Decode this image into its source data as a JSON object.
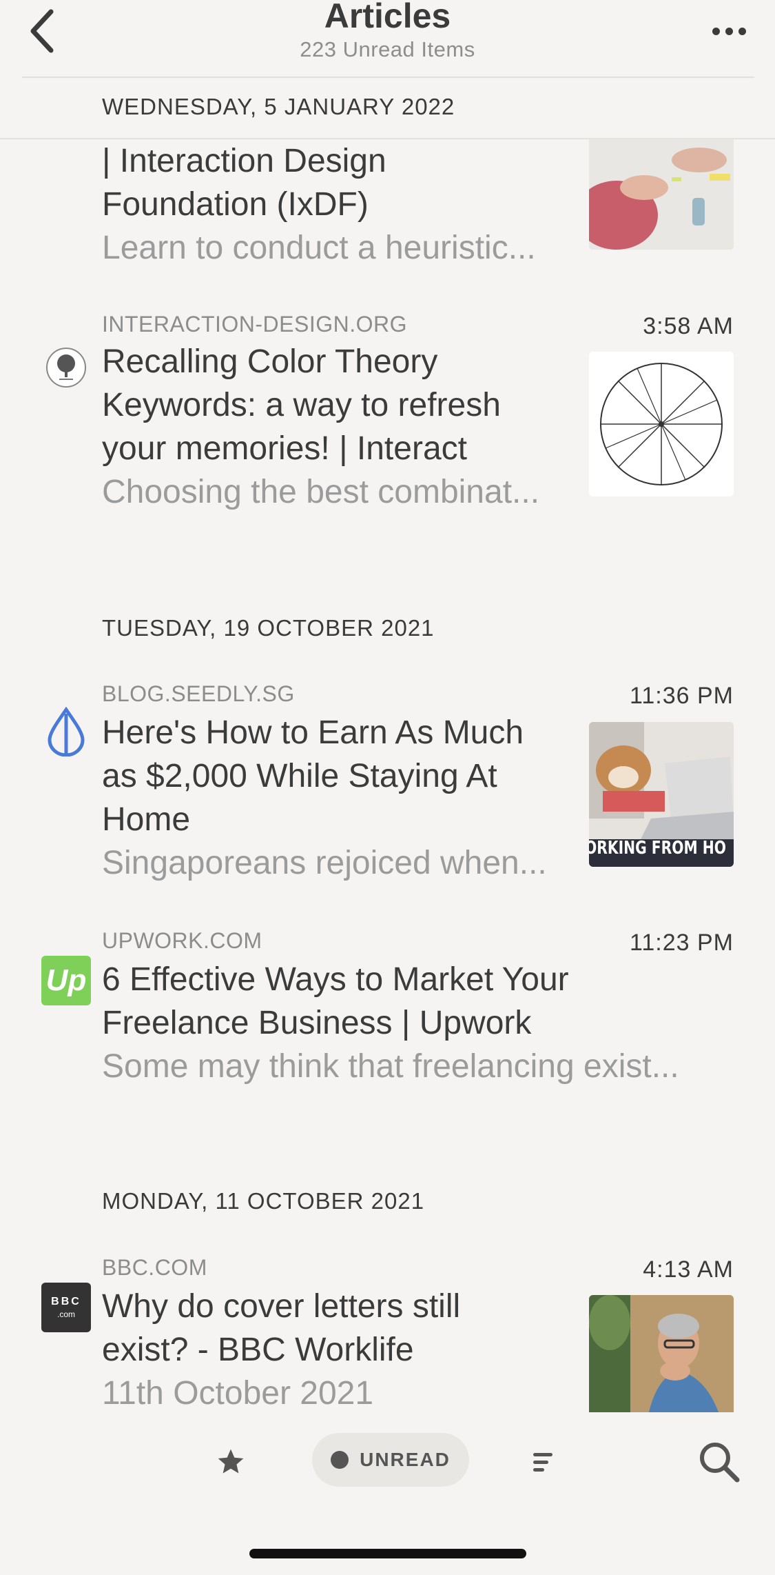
{
  "header": {
    "title": "Articles",
    "subtitle": "223 Unread Items"
  },
  "sections": [
    {
      "date": "WEDNESDAY, 5 JANUARY 2022",
      "items": [
        {
          "title_line1": "| Interaction Design",
          "title_line2": "Foundation (IxDF)",
          "summary": "Learn to conduct a heuristic..."
        },
        {
          "source": "INTERACTION-DESIGN.ORG",
          "time": "3:58 AM",
          "title_line1": "Recalling Color Theory",
          "title_line2": "Keywords: a way to refresh",
          "title_line3": "your memories! | Interact",
          "summary": "Choosing the best combinat...",
          "favicon": "tree-logo-icon"
        }
      ]
    },
    {
      "date": "TUESDAY, 19 OCTOBER 2021",
      "items": [
        {
          "source": "BLOG.SEEDLY.SG",
          "time": "11:36 PM",
          "title_line1": "Here's How to Earn As Much",
          "title_line2": "as $2,000 While Staying At",
          "title_line3": "Home",
          "summary": "Singaporeans rejoiced when...",
          "thumb_caption": "ORKING FROM HO",
          "favicon": "seedly-drop-icon"
        },
        {
          "source": "UPWORK.COM",
          "time": "11:23 PM",
          "title_line1": "6 Effective Ways to Market Your",
          "title_line2": "Freelance Business | Upwork",
          "summary": "Some may think that freelancing exist...",
          "favicon_text": "Up"
        }
      ]
    },
    {
      "date": "MONDAY, 11 OCTOBER 2021",
      "items": [
        {
          "source": "BBC.COM",
          "time": "4:13 AM",
          "title_line1": "Why do cover letters still",
          "title_line2": "exist? - BBC Worklife",
          "summary": "11th October 2021",
          "favicon_text": "BBC",
          "favicon_subtext": ".com"
        }
      ]
    }
  ],
  "bottom_bar": {
    "unread_label": "UNREAD"
  },
  "colors": {
    "background": "#f5f4f2",
    "text": "#3b3b3b",
    "muted": "#9b9b9b",
    "upwork_green": "#7ed058",
    "seedly_blue": "#4a7ad8"
  }
}
